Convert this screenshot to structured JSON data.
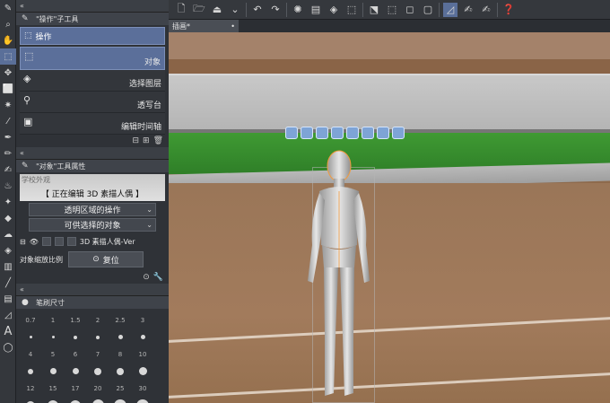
{
  "toolstrip": {
    "icons": [
      "brush-icon",
      "zoom-icon",
      "hand-icon",
      "operation-icon",
      "move-icon",
      "select-icon",
      "magic-wand-icon",
      "eyedropper-icon",
      "pen-icon",
      "pencil-icon",
      "brush2-icon",
      "airbrush-icon",
      "decoration-icon",
      "eraser-icon",
      "blend-icon",
      "fill-icon",
      "gradient-icon",
      "figure-icon",
      "frame-icon",
      "ruler-icon",
      "text-icon",
      "balloon-icon"
    ]
  },
  "subtool_panel": {
    "title": "\"操作\"子工具",
    "group": "操作",
    "items": [
      {
        "label": "对象",
        "selected": true
      },
      {
        "label": "选择图层",
        "selected": false
      },
      {
        "label": "透写台",
        "selected": false
      },
      {
        "label": "编辑时间轴",
        "selected": false
      }
    ]
  },
  "tool_property": {
    "title": "\"对象\"工具属性",
    "banner_caption": "学校外观",
    "banner_text": "【 正在编辑 3D 素描人偶 】",
    "dropdown1": "透明区域的操作",
    "dropdown2": "可供选择的对象",
    "layer_label": "3D 素描人偶-Ver",
    "scale_label": "对象缩放比例",
    "reset_label": "复位"
  },
  "brush_size": {
    "title": "笔刷尺寸",
    "sizes": [
      "0.7",
      "1",
      "1.5",
      "2",
      "2.5",
      "3",
      "4",
      "5",
      "6",
      "7",
      "8",
      "10",
      "12",
      "15",
      "17",
      "20",
      "25",
      "30"
    ]
  },
  "document": {
    "tab_label": "插画*"
  },
  "colors": {
    "accent": "#5a6f99",
    "panel": "#2f3237",
    "grass": "#3f9a33"
  }
}
